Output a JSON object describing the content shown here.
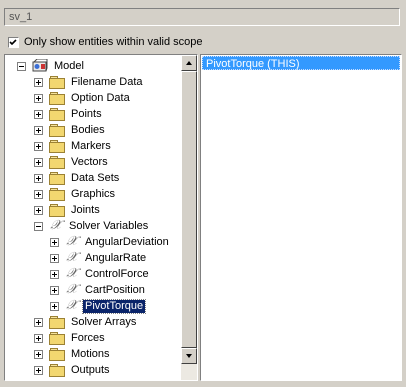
{
  "name_field": {
    "value": "sv_1"
  },
  "scope_checkbox": {
    "label": "Only show entities within valid scope",
    "checked": true
  },
  "tree": {
    "items": [
      {
        "label": "Model",
        "icon": "model-icon",
        "expander": "minus",
        "level": 0
      },
      {
        "label": "Filename Data",
        "icon": "folder-icon",
        "expander": "plus",
        "level": 1
      },
      {
        "label": "Option Data",
        "icon": "folder-icon",
        "expander": "plus",
        "level": 1
      },
      {
        "label": "Points",
        "icon": "folder-icon",
        "expander": "plus",
        "level": 1
      },
      {
        "label": "Bodies",
        "icon": "folder-icon",
        "expander": "plus",
        "level": 1
      },
      {
        "label": "Markers",
        "icon": "folder-icon",
        "expander": "plus",
        "level": 1
      },
      {
        "label": "Vectors",
        "icon": "folder-icon",
        "expander": "plus",
        "level": 1
      },
      {
        "label": "Data Sets",
        "icon": "folder-icon",
        "expander": "plus",
        "level": 1
      },
      {
        "label": "Graphics",
        "icon": "folder-icon",
        "expander": "plus",
        "level": 1
      },
      {
        "label": "Joints",
        "icon": "folder-icon",
        "expander": "plus",
        "level": 1
      },
      {
        "label": "Solver Variables",
        "icon": "variable-icon",
        "expander": "minus",
        "level": 1
      },
      {
        "label": "AngularDeviation",
        "icon": "variable-icon",
        "expander": "plus",
        "level": 2
      },
      {
        "label": "AngularRate",
        "icon": "variable-icon",
        "expander": "plus",
        "level": 2
      },
      {
        "label": "ControlForce",
        "icon": "variable-icon",
        "expander": "plus",
        "level": 2
      },
      {
        "label": "CartPosition",
        "icon": "variable-icon",
        "expander": "plus",
        "level": 2
      },
      {
        "label": "PivotTorque",
        "icon": "variable-icon",
        "expander": "plus",
        "level": 2,
        "selected": true
      },
      {
        "label": "Solver Arrays",
        "icon": "folder-icon",
        "expander": "plus",
        "level": 1
      },
      {
        "label": "Forces",
        "icon": "folder-icon",
        "expander": "plus",
        "level": 1
      },
      {
        "label": "Motions",
        "icon": "folder-icon",
        "expander": "plus",
        "level": 1
      },
      {
        "label": "Outputs",
        "icon": "folder-icon",
        "expander": "plus",
        "level": 1
      }
    ]
  },
  "list": {
    "items": [
      {
        "label": "PivotTorque (THIS)",
        "selected": true
      }
    ]
  },
  "colors": {
    "selection": "#0a246a",
    "list_selection": "#3399ff",
    "panel_bg": "#d4d0c8"
  }
}
